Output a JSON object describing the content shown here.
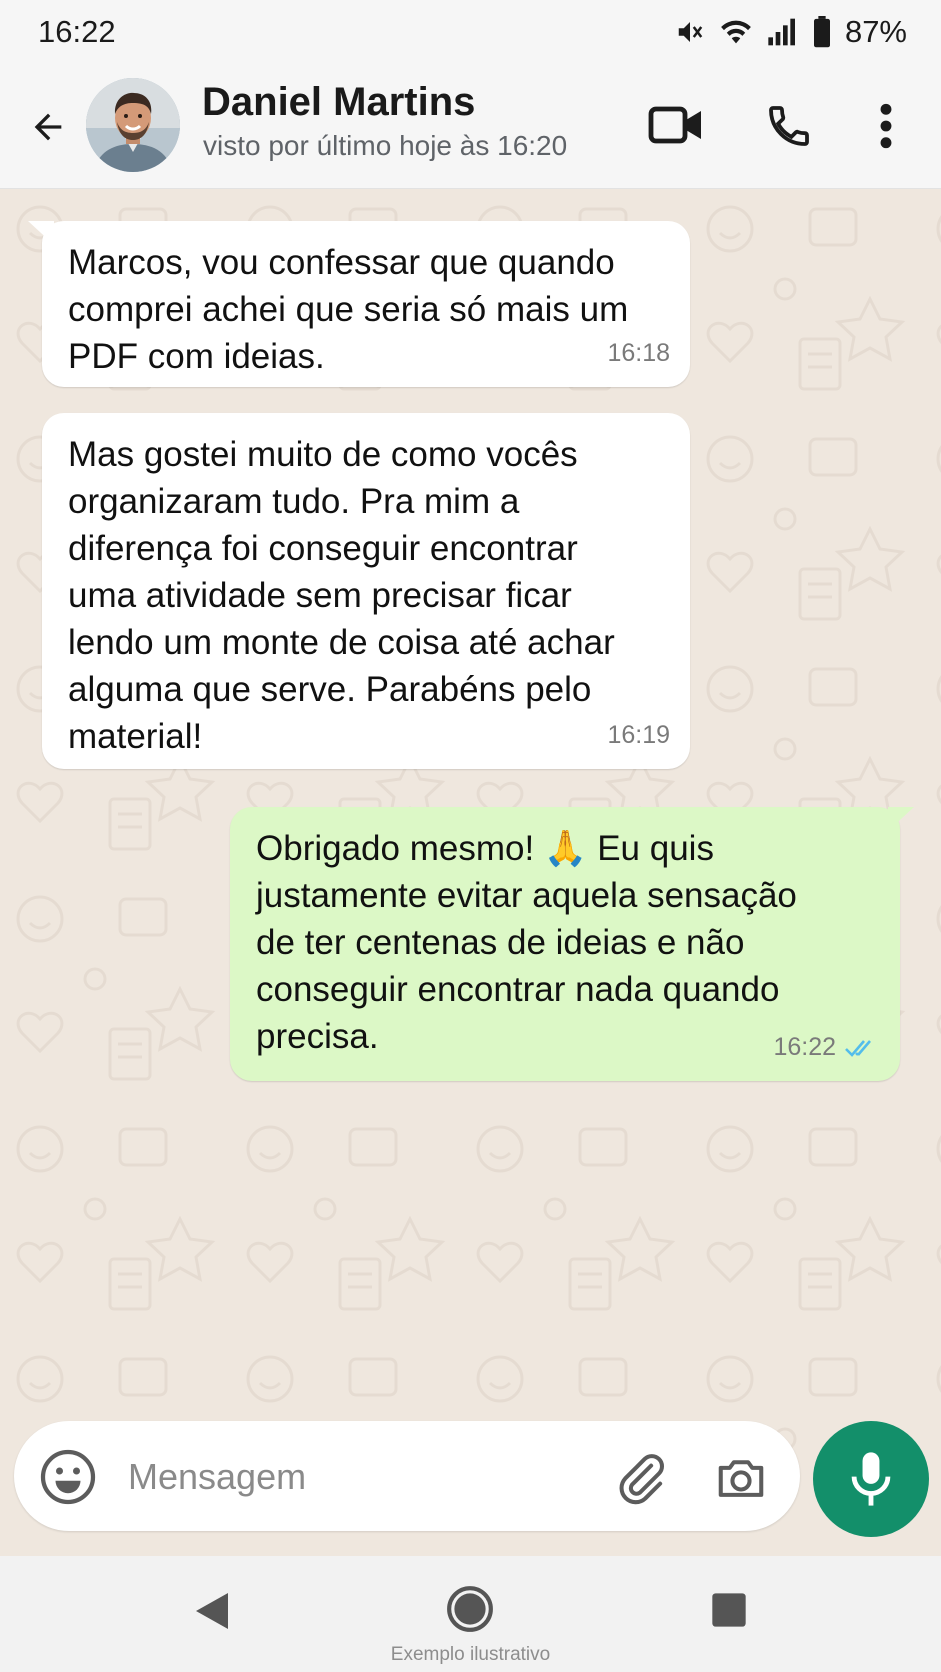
{
  "status_bar": {
    "time": "16:22",
    "battery": "87%",
    "icons": [
      "mute-icon",
      "wifi-icon",
      "signal-icon",
      "battery-icon"
    ]
  },
  "header": {
    "contact_name": "Daniel Martins",
    "last_seen": "visto por último hoje às 16:20",
    "icons": [
      "back-arrow-icon",
      "avatar",
      "video-call-icon",
      "phone-icon",
      "more-vert-icon"
    ]
  },
  "messages": [
    {
      "direction": "incoming",
      "text": "Marcos, vou confessar que quando\ncomprei achei que seria só mais um\nPDF com ideias.",
      "time": "16:18"
    },
    {
      "direction": "incoming",
      "text": "Mas gostei muito de como vocês\norganizaram tudo. Pra mim a\ndiferença foi conseguir encontrar\numa atividade sem precisar ficar\nlendo um monte de coisa até achar\nalguma que serve. Parabéns pelo\nmaterial!",
      "time": "16:19"
    },
    {
      "direction": "outgoing",
      "text": "Obrigado mesmo! 🙏 Eu quis\njustamente evitar aquela sensação\nde ter centenas de ideias e não\nconseguir encontrar nada quando\nprecisa.",
      "time": "16:22",
      "status": "read"
    }
  ],
  "composer": {
    "placeholder": "Mensagem",
    "value": ""
  },
  "nav_bar": {
    "watermark": "Exemplo ilustrativo"
  },
  "colors": {
    "chat_background": "#efe7de",
    "incoming_bubble": "#ffffff",
    "outgoing_bubble": "#dcf8c6",
    "accent_green": "#138f6a",
    "read_ticks": "#53bdeb"
  }
}
